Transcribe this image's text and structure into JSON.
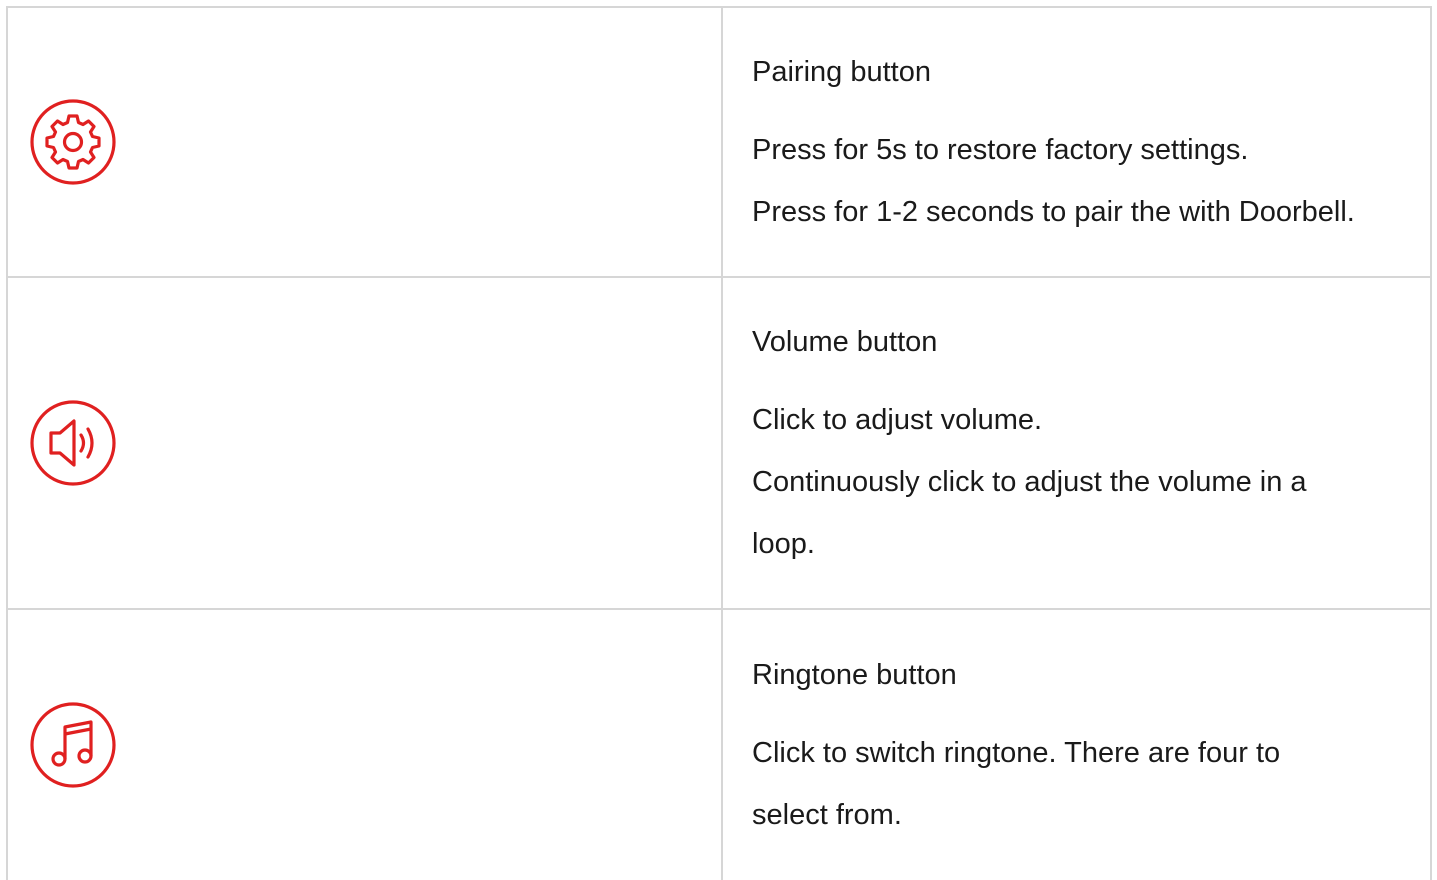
{
  "colors": {
    "accent": "#e02020",
    "border": "#d6d6d6",
    "text": "#1a1a1a"
  },
  "rows": [
    {
      "icon": "gear-icon",
      "title": "Pairing button",
      "lines": [
        "Press for 5s to restore factory settings.",
        "Press for 1-2 seconds to pair the with Doorbell."
      ]
    },
    {
      "icon": "speaker-icon",
      "title": "Volume button",
      "lines": [
        "Click to adjust volume.",
        "Continuously click to adjust the volume in a",
        "loop."
      ]
    },
    {
      "icon": "music-note-icon",
      "title": "Ringtone button",
      "lines": [
        "Click to switch ringtone. There are four to",
        "select from."
      ]
    }
  ]
}
